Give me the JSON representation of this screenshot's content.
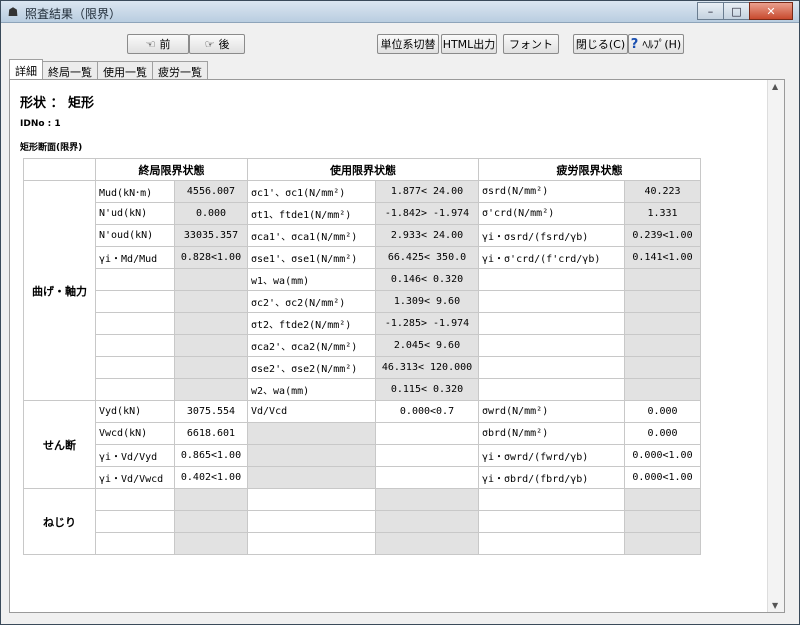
{
  "window": {
    "title": "照査結果（限界）",
    "minimize": "–",
    "maximize": "□",
    "close": "✕"
  },
  "toolbar": {
    "prev": "前",
    "next": "後",
    "units": "単位系切替",
    "html": "HTML出力",
    "font": "フォント",
    "close": "閉じる(C)",
    "help": "ﾍﾙﾌﾟ(H)"
  },
  "tabs": [
    "詳細",
    "終局一覧",
    "使用一覧",
    "疲労一覧"
  ],
  "content": {
    "shape_title": "形状 ： 矩形",
    "idno": "IDNo : 1",
    "section_title": "矩形断面(限界)"
  },
  "table": {
    "headers": [
      "終局限界状態",
      "使用限界状態",
      "疲労限界状態"
    ],
    "groups": [
      "曲げ・軸力",
      "せん断",
      "ねじり"
    ],
    "rows": [
      [
        "Mud(kN･m)",
        "4556.007",
        "σc1'、σc1(N/mm²)",
        "1.877< 24.00",
        "σsrd(N/mm²)",
        "40.223"
      ],
      [
        "N'ud(kN)",
        "0.000",
        "σt1、ftde1(N/mm²)",
        "-1.842> -1.974",
        "σ'crd(N/mm²)",
        "1.331"
      ],
      [
        "N'oud(kN)",
        "33035.357",
        "σca1'、σca1(N/mm²)",
        "2.933< 24.00",
        "γi・σsrd/(fsrd/γb)",
        "0.239<1.00"
      ],
      [
        "γi・Md/Mud",
        "0.828<1.00",
        "σse1'、σse1(N/mm²)",
        "66.425< 350.0",
        "γi・σ'crd/(f'crd/γb)",
        "0.141<1.00"
      ],
      [
        "",
        "",
        "w1、wa(mm)",
        "0.146< 0.320",
        "",
        ""
      ],
      [
        "",
        "",
        "σc2'、σc2(N/mm²)",
        "1.309< 9.60",
        "",
        ""
      ],
      [
        "",
        "",
        "σt2、ftde2(N/mm²)",
        "-1.285> -1.974",
        "",
        ""
      ],
      [
        "",
        "",
        "σca2'、σca2(N/mm²)",
        "2.045< 9.60",
        "",
        ""
      ],
      [
        "",
        "",
        "σse2'、σse2(N/mm²)",
        "46.313< 120.000",
        "",
        ""
      ],
      [
        "",
        "",
        "w2、wa(mm)",
        "0.115< 0.320",
        "",
        ""
      ],
      [
        "Vyd(kN)",
        "3075.554",
        "Vd/Vcd",
        "0.000<0.7",
        "σwrd(N/mm²)",
        "0.000"
      ],
      [
        "Vwcd(kN)",
        "6618.601",
        "",
        "",
        "σbrd(N/mm²)",
        "0.000"
      ],
      [
        "γi・Vd/Vyd",
        "0.865<1.00",
        "",
        "",
        "γi・σwrd/(fwrd/γb)",
        "0.000<1.00"
      ],
      [
        "γi・Vd/Vwcd",
        "0.402<1.00",
        "",
        "",
        "γi・σbrd/(fbrd/γb)",
        "0.000<1.00"
      ],
      [
        "",
        "",
        "",
        "",
        "",
        ""
      ],
      [
        "",
        "",
        "",
        "",
        "",
        ""
      ],
      [
        "",
        "",
        "",
        "",
        "",
        ""
      ]
    ]
  }
}
